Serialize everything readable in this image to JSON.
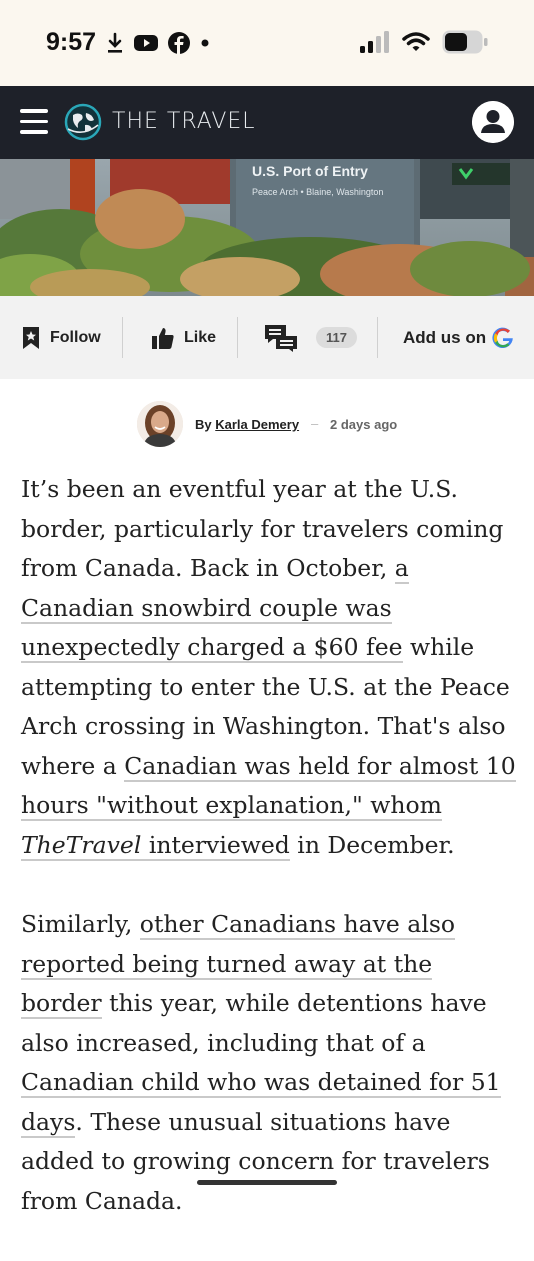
{
  "status_bar": {
    "time": "9:57",
    "left_icons": [
      "download-icon",
      "youtube-icon",
      "facebook-icon",
      "dot-icon"
    ],
    "right_icons": [
      "signal-icon",
      "wifi-icon",
      "battery-icon"
    ]
  },
  "nav": {
    "logo_text": "THE TRAVEL",
    "menu_icon": "hamburger-icon",
    "account_icon": "account-icon"
  },
  "hero": {
    "sign_title": "U.S. Port of Entry",
    "sign_subtitle": "Peace Arch • Blaine, Washington"
  },
  "actions": {
    "follow_label": "Follow",
    "like_label": "Like",
    "comments_count": "117",
    "add_us_label": "Add us on"
  },
  "byline": {
    "by": "By",
    "author": "Karla Demery",
    "dash": "–",
    "time": "2 days ago"
  },
  "article": {
    "p1": {
      "t1": "It’s been an eventful year at the U.S. border, particularly for travelers coming from Canada. Back in October, ",
      "l1": "a Canadian snowbird couple was unexpectedly charged a $60 fee",
      "t2": " while attempting to enter the U.S. at the Peace Arch crossing in Washington. That's also where a ",
      "l2": "Canadian was held for almost 10 hours \"without explanation,\" whom ",
      "l2_em": "TheTravel",
      "l2_tail": " interviewed",
      "t3": " in December."
    },
    "p2": {
      "t1": "Similarly, ",
      "l1": "other Canadians have also reported being turned away at the border",
      "t2": " this year, while detentions have also increased, including that of a ",
      "l2": "Canadian child who was detained for 51 days",
      "t3": ". These unusual situations have added to growing concern for travelers from Canada."
    }
  },
  "colors": {
    "nav_bg": "#1e2129",
    "status_bg": "#fbf7ef",
    "action_bar_bg": "#f2f2f2",
    "accent_teal": "#2aa7b8"
  }
}
